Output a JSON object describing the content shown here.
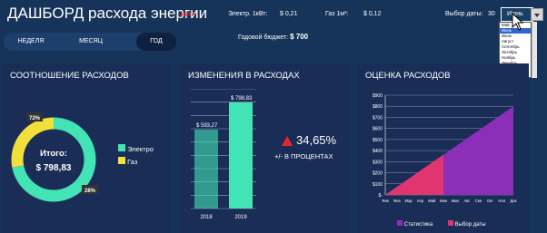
{
  "header": {
    "title": "ДАШБОРД расхода энергии",
    "beta": "BETA",
    "elec_label": "Электр. 1кВт:",
    "elec_price": "$ 0,21",
    "gas_label": "Газ 1м³:",
    "gas_price": "$ 0,12",
    "date_label": "Выбор даты:",
    "date_day": "30",
    "month_value": "Июнь",
    "month_options": [
      "Май",
      "Июнь",
      "Июль",
      "Август",
      "Сентябрь",
      "Октябрь",
      "Ноябрь",
      "Декабрь"
    ],
    "budget_label": "Годовой бюджет:",
    "budget_value": "$ 700"
  },
  "period_tabs": [
    "НЕДЕЛЯ",
    "МЕСЯЦ",
    "ГОД"
  ],
  "panel1": {
    "title": "СООТНОШЕНИЕ РАСХОДОВ",
    "total_label": "Итого:",
    "total_value": "$ 798,83",
    "pct_elec": "72%",
    "pct_gas": "28%",
    "legend_elec": "Электро",
    "legend_gas": "Газ"
  },
  "panel2": {
    "title": "ИЗМЕНЕНИЯ В РАСХОДАХ",
    "change_value": "34,65%",
    "change_label": "+/- В ПРОЦЕНТАХ"
  },
  "panel3": {
    "title": "ОЦЕНКА РАСХОДОВ",
    "legend_stat": "Статистика",
    "legend_sel": "Выбор даты"
  },
  "colors": {
    "elec": "#42e3b4",
    "gas": "#f2e03a",
    "stat": "#8c2fb8",
    "sel": "#e0356f"
  },
  "chart_data": [
    {
      "type": "pie",
      "title": "СООТНОШЕНИЕ РАСХОДОВ",
      "categories": [
        "Электро",
        "Газ"
      ],
      "values": [
        72,
        28
      ],
      "labels": [
        "72%",
        "28%"
      ]
    },
    {
      "type": "bar",
      "title": "ИЗМЕНЕНИЯ В РАСХОДАХ",
      "categories": [
        "2018",
        "2019"
      ],
      "values": [
        593.27,
        798.83
      ],
      "labels": [
        "$ 593,27",
        "$ 798,83"
      ],
      "ylim": [
        0,
        900
      ]
    },
    {
      "type": "area",
      "title": "ОЦЕНКА РАСХОДОВ",
      "categories": [
        "Янв",
        "Фев",
        "Мар",
        "Апр",
        "Май",
        "Июн",
        "Июл",
        "Авг",
        "Сен",
        "Окт",
        "Ноя",
        "Дек"
      ],
      "yticks": [
        "$-",
        "$100",
        "$200",
        "$300",
        "$400",
        "$500",
        "$600",
        "$700",
        "$800",
        "$900"
      ],
      "ylim": [
        0,
        900
      ],
      "series": [
        {
          "name": "Статистика",
          "values": [
            0,
            73,
            145,
            218,
            291,
            363,
            436,
            509,
            581,
            654,
            727,
            799
          ]
        },
        {
          "name": "Выбор даты",
          "values": [
            0,
            73,
            145,
            218,
            291,
            363,
            null,
            null,
            null,
            null,
            null,
            null
          ]
        }
      ]
    }
  ]
}
